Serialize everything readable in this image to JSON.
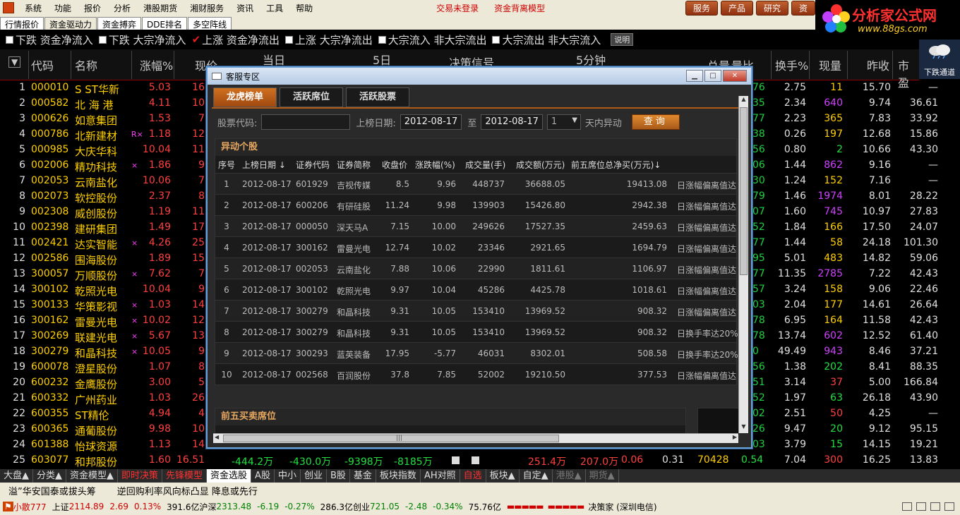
{
  "menu": {
    "items": [
      "系统",
      "功能",
      "报价",
      "分析",
      "港股期货",
      "湘财服务",
      "资讯",
      "工具",
      "帮助"
    ],
    "status_login": "交易未登录",
    "status_model": "资金背离模型",
    "right_buttons": [
      "服务",
      "产品",
      "研究",
      "资"
    ]
  },
  "brand": {
    "name": "分析家公式网",
    "url": "www.88gs.com"
  },
  "tabs": [
    "行情报价",
    "资金驱动力",
    "资金搏弈",
    "DDE排名",
    "多空阵线"
  ],
  "filters": {
    "items": [
      {
        "label": "下跌 资金净流入",
        "checked": false
      },
      {
        "label": "下跌 大宗净流入",
        "checked": false
      },
      {
        "label": "上涨 资金净流出",
        "checked": true
      },
      {
        "label": "上涨 大宗净流出",
        "checked": false
      },
      {
        "label": "大宗流入 非大宗流出",
        "checked": false
      },
      {
        "label": "大宗流出 非大宗流入",
        "checked": false
      }
    ],
    "explain": "说明"
  },
  "weather": {
    "label": "下跌通道"
  },
  "grid": {
    "headers": {
      "code": "代码",
      "name": "名称",
      "pct": "涨幅%",
      "price": "现价",
      "day": "当日",
      "day5": "5日",
      "decision": "决策信号",
      "min5": "5分钟",
      "total": "总量",
      "ratio": "量比",
      "turnover": "换手%",
      "vol": "现量",
      "prev": "昨收",
      "pe": "市盈"
    },
    "rows": [
      {
        "no": "1",
        "code": "000010",
        "name": "S ST华新",
        "flag": "",
        "pct": "5.03",
        "price": "16",
        "edge": "76",
        "turn": "2.75",
        "vol": "11",
        "vol_color": "#ffd000",
        "prev": "15.70",
        "pe": "—"
      },
      {
        "no": "2",
        "code": "000582",
        "name": "北 海 港",
        "flag": "",
        "pct": "4.11",
        "price": "10",
        "edge": "35",
        "turn": "2.34",
        "vol": "640",
        "vol_color": "#d040ff",
        "prev": "9.74",
        "pe": "36.61"
      },
      {
        "no": "3",
        "code": "000626",
        "name": "如意集团",
        "flag": "",
        "pct": "1.53",
        "price": "7",
        "edge": "77",
        "turn": "2.23",
        "vol": "365",
        "vol_color": "#ffd000",
        "prev": "7.83",
        "pe": "33.92"
      },
      {
        "no": "4",
        "code": "000786",
        "name": "北新建材",
        "flag": "R×",
        "pct": "1.18",
        "price": "12",
        "edge": "38",
        "turn": "0.26",
        "vol": "197",
        "vol_color": "#ffd000",
        "prev": "12.68",
        "pe": "15.86"
      },
      {
        "no": "5",
        "code": "000985",
        "name": "大庆华科",
        "flag": "",
        "pct": "10.04",
        "price": "11",
        "edge": "56",
        "turn": "0.80",
        "vol": "2",
        "vol_color": "#20e040",
        "prev": "10.66",
        "pe": "43.30"
      },
      {
        "no": "6",
        "code": "002006",
        "name": "精功科技",
        "flag": "×",
        "pct": "1.86",
        "price": "9",
        "edge": "06",
        "turn": "1.44",
        "vol": "862",
        "vol_color": "#d040ff",
        "prev": "9.16",
        "pe": "—"
      },
      {
        "no": "7",
        "code": "002053",
        "name": "云南盐化",
        "flag": "",
        "pct": "10.06",
        "price": "7",
        "edge": "30",
        "turn": "1.24",
        "vol": "152",
        "vol_color": "#ffd000",
        "prev": "7.16",
        "pe": "—"
      },
      {
        "no": "8",
        "code": "002073",
        "name": "软控股份",
        "flag": "",
        "pct": "2.37",
        "price": "8",
        "edge": "79",
        "turn": "1.46",
        "vol": "1974",
        "vol_color": "#d040ff",
        "prev": "8.01",
        "pe": "28.22"
      },
      {
        "no": "9",
        "code": "002308",
        "name": "威创股份",
        "flag": "",
        "pct": "1.19",
        "price": "11",
        "edge": "07",
        "turn": "1.60",
        "vol": "745",
        "vol_color": "#d040ff",
        "prev": "10.97",
        "pe": "27.83"
      },
      {
        "no": "10",
        "code": "002398",
        "name": "建研集团",
        "flag": "",
        "pct": "1.49",
        "price": "17",
        "edge": "52",
        "turn": "1.84",
        "vol": "166",
        "vol_color": "#ffd000",
        "prev": "17.50",
        "pe": "24.07"
      },
      {
        "no": "11",
        "code": "002421",
        "name": "达实智能",
        "flag": "×",
        "pct": "4.26",
        "price": "25",
        "edge": "77",
        "turn": "1.44",
        "vol": "58",
        "vol_color": "#ffd000",
        "prev": "24.18",
        "pe": "101.30"
      },
      {
        "no": "12",
        "code": "002586",
        "name": "围海股份",
        "flag": "",
        "pct": "1.89",
        "price": "15",
        "edge": "95",
        "turn": "5.01",
        "vol": "483",
        "vol_color": "#ffd000",
        "prev": "14.82",
        "pe": "59.06"
      },
      {
        "no": "13",
        "code": "300057",
        "name": "万顺股份",
        "flag": "×",
        "pct": "7.62",
        "price": "7",
        "edge": "77",
        "turn": "11.35",
        "vol": "2785",
        "vol_color": "#d040ff",
        "prev": "7.22",
        "pe": "42.43"
      },
      {
        "no": "14",
        "code": "300102",
        "name": "乾照光电",
        "flag": "",
        "pct": "10.04",
        "price": "9",
        "edge": "57",
        "turn": "3.24",
        "vol": "158",
        "vol_color": "#ffd000",
        "prev": "9.06",
        "pe": "22.46"
      },
      {
        "no": "15",
        "code": "300133",
        "name": "华策影视",
        "flag": "×",
        "pct": "1.03",
        "price": "14",
        "edge": "03",
        "turn": "2.04",
        "vol": "177",
        "vol_color": "#ffd000",
        "prev": "14.61",
        "pe": "26.64"
      },
      {
        "no": "16",
        "code": "300162",
        "name": "雷曼光电",
        "flag": "×",
        "pct": "10.02",
        "price": "12",
        "edge": "78",
        "turn": "6.95",
        "vol": "164",
        "vol_color": "#ffd000",
        "prev": "11.58",
        "pe": "42.43"
      },
      {
        "no": "17",
        "code": "300269",
        "name": "联建光电",
        "flag": "×",
        "pct": "5.67",
        "price": "13",
        "edge": "78",
        "turn": "13.74",
        "vol": "602",
        "vol_color": "#d040ff",
        "prev": "12.52",
        "pe": "61.40"
      },
      {
        "no": "18",
        "code": "300279",
        "name": "和晶科技",
        "flag": "×",
        "pct": "10.05",
        "price": "9",
        "edge": "0",
        "turn": "49.49",
        "vol": "943",
        "vol_color": "#d040ff",
        "prev": "8.46",
        "pe": "37.21"
      },
      {
        "no": "19",
        "code": "600078",
        "name": "澄星股份",
        "flag": "",
        "pct": "1.07",
        "price": "8",
        "edge": "56",
        "turn": "1.38",
        "vol": "202",
        "vol_color": "#20e040",
        "prev": "8.41",
        "pe": "88.35"
      },
      {
        "no": "20",
        "code": "600232",
        "name": "金鹰股份",
        "flag": "",
        "pct": "3.00",
        "price": "5",
        "edge": "51",
        "turn": "3.14",
        "vol": "37",
        "vol_color": "#ff4040",
        "prev": "5.00",
        "pe": "166.84"
      },
      {
        "no": "21",
        "code": "600332",
        "name": "广州药业",
        "flag": "",
        "pct": "1.03",
        "price": "26",
        "edge": "52",
        "turn": "1.97",
        "vol": "63",
        "vol_color": "#20e040",
        "prev": "26.18",
        "pe": "43.90"
      },
      {
        "no": "22",
        "code": "600355",
        "name": "ST精伦",
        "flag": "",
        "pct": "4.94",
        "price": "4",
        "edge": "02",
        "turn": "2.51",
        "vol": "50",
        "vol_color": "#ff4040",
        "prev": "4.25",
        "pe": "—"
      },
      {
        "no": "23",
        "code": "600365",
        "name": "通葡股份",
        "flag": "",
        "pct": "9.98",
        "price": "10",
        "edge": "26",
        "turn": "9.47",
        "vol": "20",
        "vol_color": "#20e040",
        "prev": "9.12",
        "pe": "95.15"
      },
      {
        "no": "24",
        "code": "601388",
        "name": "怡球资源",
        "flag": "",
        "pct": "1.13",
        "price": "14",
        "edge": "03",
        "turn": "3.79",
        "vol": "15",
        "vol_color": "#20e040",
        "prev": "14.15",
        "pe": "19.21"
      },
      {
        "no": "25",
        "code": "603077",
        "name": "和邦股份",
        "flag": "",
        "pct": "1.60",
        "price": "16.51",
        "edge": "",
        "turn": "7.04",
        "vol": "300",
        "vol_color": "#ff4040",
        "prev": "16.25",
        "pe": "13.83"
      }
    ],
    "row25_extra": [
      "-444.2万",
      "-430.0万",
      "-9398万",
      "-8185万",
      "251.4万",
      "207.0万",
      "0.06",
      "0.31",
      "70428",
      "0.54"
    ]
  },
  "bottom_tabs": [
    {
      "label": "大盘▲",
      "style": ""
    },
    {
      "label": "分类▲",
      "style": ""
    },
    {
      "label": "资金模型▲",
      "style": ""
    },
    {
      "label": "即时决策",
      "style": "red"
    },
    {
      "label": "先锋模型",
      "style": "red"
    },
    {
      "label": "资金选股",
      "style": "hl"
    },
    {
      "label": "A股",
      "style": ""
    },
    {
      "label": "中小",
      "style": ""
    },
    {
      "label": "创业",
      "style": ""
    },
    {
      "label": "B股",
      "style": ""
    },
    {
      "label": "基金",
      "style": ""
    },
    {
      "label": "板块指数",
      "style": ""
    },
    {
      "label": "AH对照",
      "style": ""
    },
    {
      "label": "自选",
      "style": "red"
    },
    {
      "label": "板块▲",
      "style": ""
    },
    {
      "label": "自定▲",
      "style": ""
    },
    {
      "label": "港股▲",
      "style": "dim"
    },
    {
      "label": "期货▲",
      "style": "dim"
    }
  ],
  "news": [
    "溢”华安国泰或拔头筹",
    "逆回购利率风向标凸显 降息或先行"
  ],
  "statusbar": {
    "msg_label": "小散777",
    "sh_name": "上证",
    "sh_val": "2114.89",
    "sh_chg": "2.69",
    "sh_pct": "0.13%",
    "sh_amt": "391.6亿",
    "sz_name": "沪深",
    "sz_val": "2313.48",
    "sz_chg": "-6.19",
    "sz_pct": "-0.27%",
    "sz_amt": "286.3亿",
    "cy_name": "创业",
    "cy_val": "721.05",
    "cy_chg": "-2.48",
    "cy_pct": "-0.34%",
    "cy_amt": "75.76亿",
    "broker": "决策家 (深圳电信)"
  },
  "dialog": {
    "title": "客服专区",
    "tabs": [
      "龙虎榜单",
      "活跃席位",
      "活跃股票"
    ],
    "query": {
      "code_label": "股票代码:",
      "code_value": "",
      "date_label": "上榜日期:",
      "date_from": "2012-08-17",
      "to_label": "至",
      "date_to": "2012-08-17",
      "days_value": "1",
      "days_suffix": "天内异动",
      "button": "查询"
    },
    "panel1_title": "异动个股",
    "columns": [
      "序号",
      "上榜日期 ↓",
      "证券代码",
      "证券简称",
      "收盘价",
      "涨跌幅(%)",
      "成交量(手)",
      "成交额(万元)",
      "前五席位总净买(万元)↓"
    ],
    "rows": [
      {
        "idx": "1",
        "date": "2012-08-17",
        "code": "601929",
        "name": "吉视传媒",
        "close": "8.5",
        "chg": "9.96",
        "vol": "448737",
        "amt": "36688.05",
        "net": "19413.08",
        "reason": "日涨幅偏离值达"
      },
      {
        "idx": "2",
        "date": "2012-08-17",
        "code": "600206",
        "name": "有研硅股",
        "close": "11.24",
        "chg": "9.98",
        "vol": "139903",
        "amt": "15426.80",
        "net": "2942.38",
        "reason": "日涨幅偏离值达"
      },
      {
        "idx": "3",
        "date": "2012-08-17",
        "code": "000050",
        "name": "深天马A",
        "close": "7.15",
        "chg": "10.00",
        "vol": "249626",
        "amt": "17527.35",
        "net": "2459.63",
        "reason": "日涨幅偏离值达"
      },
      {
        "idx": "4",
        "date": "2012-08-17",
        "code": "300162",
        "name": "雷曼光电",
        "close": "12.74",
        "chg": "10.02",
        "vol": "23346",
        "amt": "2921.65",
        "net": "1694.79",
        "reason": "日涨幅偏离值达"
      },
      {
        "idx": "5",
        "date": "2012-08-17",
        "code": "002053",
        "name": "云南盐化",
        "close": "7.88",
        "chg": "10.06",
        "vol": "22990",
        "amt": "1811.61",
        "net": "1106.97",
        "reason": "日涨幅偏离值达"
      },
      {
        "idx": "6",
        "date": "2012-08-17",
        "code": "300102",
        "name": "乾照光电",
        "close": "9.97",
        "chg": "10.04",
        "vol": "45286",
        "amt": "4425.78",
        "net": "1018.61",
        "reason": "日涨幅偏离值达"
      },
      {
        "idx": "7",
        "date": "2012-08-17",
        "code": "300279",
        "name": "和晶科技",
        "close": "9.31",
        "chg": "10.05",
        "vol": "153410",
        "amt": "13969.52",
        "net": "908.32",
        "reason": "日涨幅偏离值达"
      },
      {
        "idx": "8",
        "date": "2012-08-17",
        "code": "300279",
        "name": "和晶科技",
        "close": "9.31",
        "chg": "10.05",
        "vol": "153410",
        "amt": "13969.52",
        "net": "908.32",
        "reason": "日换手率达20%"
      },
      {
        "idx": "9",
        "date": "2012-08-17",
        "code": "300293",
        "name": "蓝英装备",
        "close": "17.95",
        "chg": "-5.77",
        "vol": "46031",
        "amt": "8302.01",
        "net": "508.58",
        "reason": "日换手率达20%"
      },
      {
        "idx": "10",
        "date": "2012-08-17",
        "code": "002568",
        "name": "百润股份",
        "close": "37.8",
        "chg": "7.85",
        "vol": "52002",
        "amt": "19210.50",
        "net": "377.53",
        "reason": "日涨幅偏离值达"
      }
    ],
    "panel2_title": "前五买卖席位"
  }
}
